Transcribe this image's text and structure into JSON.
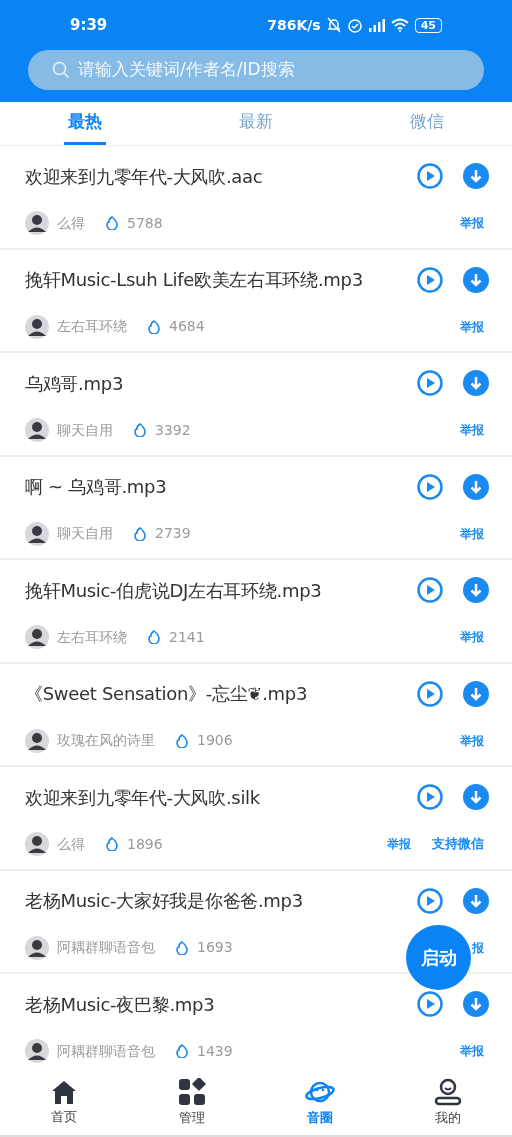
{
  "status_bar": {
    "time": "9:39",
    "speed": "786K/s",
    "battery": "45"
  },
  "search": {
    "placeholder": "请输入关键词/作者名/ID搜索"
  },
  "tabs": [
    {
      "label": "最热",
      "selected": true
    },
    {
      "label": "最新",
      "selected": false
    },
    {
      "label": "微信",
      "selected": false
    }
  ],
  "items": [
    {
      "title": "欢迎来到九零年代-大风吹.aac",
      "author": "么得",
      "count": "5788",
      "report": "举报"
    },
    {
      "title": "挽轩Music-Lsuh Life欧美左右耳环绕.mp3",
      "author": "左右耳环绕",
      "count": "4684",
      "report": "举报"
    },
    {
      "title": "乌鸡哥.mp3",
      "author": "聊天自用",
      "count": "3392",
      "report": "举报"
    },
    {
      "title": "啊 ~ 乌鸡哥.mp3",
      "author": "聊天自用",
      "count": "2739",
      "report": "举报"
    },
    {
      "title": "挽轩Music-伯虎说DJ左右耳环绕.mp3",
      "author": "左右耳环绕",
      "count": "2141",
      "report": "举报"
    },
    {
      "title": "《Sweet Sensation》-忘尘❦.mp3",
      "author": "玫瑰在风的诗里",
      "count": "1906",
      "report": "举报"
    },
    {
      "title": "欢迎来到九零年代-大风吹.silk",
      "author": "么得",
      "count": "1896",
      "report": "举报",
      "wechat": "支持微信"
    },
    {
      "title": "老杨Music-大家好我是你爸爸.mp3",
      "author": "阿耦群聊语音包",
      "count": "1693",
      "report": "报"
    },
    {
      "title": "老杨Music-夜巴黎.mp3",
      "author": "阿耦群聊语音包",
      "count": "1439",
      "report": "举报"
    }
  ],
  "fab": "启动",
  "nav": [
    {
      "label": "首页",
      "selected": false
    },
    {
      "label": "管理",
      "selected": false
    },
    {
      "label": "音圈",
      "selected": true
    },
    {
      "label": "我的",
      "selected": false
    }
  ]
}
